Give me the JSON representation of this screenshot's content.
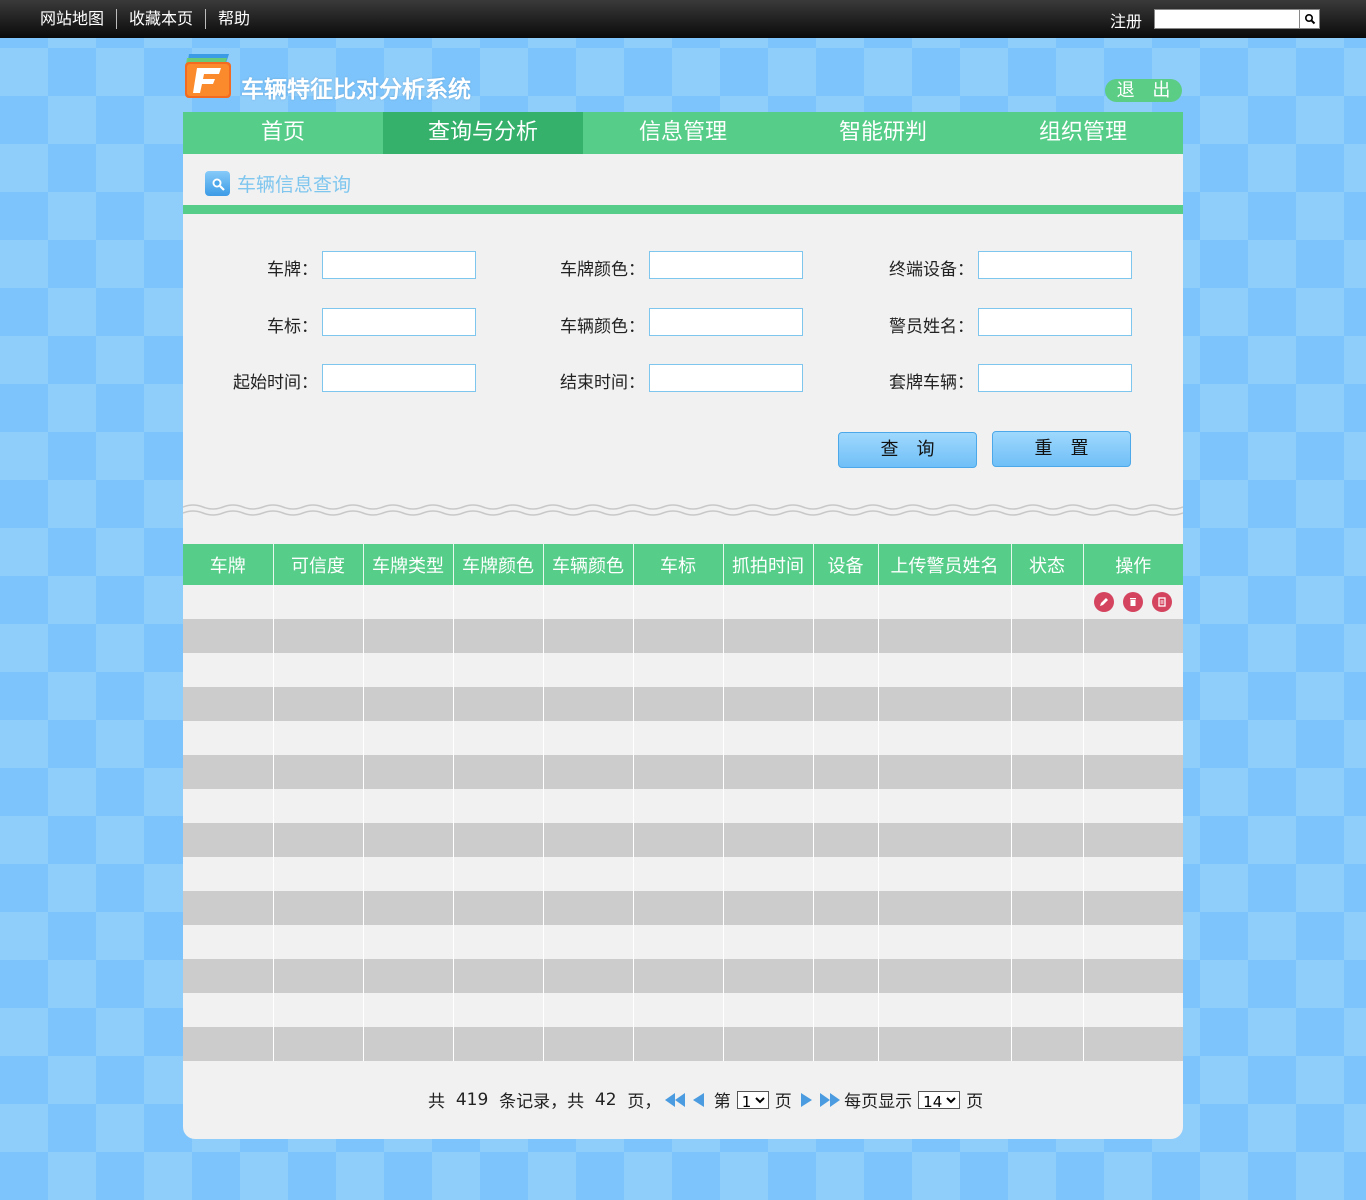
{
  "topbar": {
    "links": [
      "网站地图",
      "收藏本页",
      "帮助"
    ],
    "register": "注册",
    "search_value": ""
  },
  "header": {
    "title": "车辆特征比对分析系统",
    "logout": "退 出"
  },
  "nav": {
    "items": [
      "首页",
      "查询与分析",
      "信息管理",
      "智能研判",
      "组织管理"
    ],
    "active_index": 1
  },
  "section": {
    "title": "车辆信息查询"
  },
  "form": {
    "plate": "车牌：",
    "plate_color": "车牌颜色：",
    "terminal": "终端设备：",
    "logo": "车标：",
    "vehicle_color": "车辆颜色：",
    "officer": "警员姓名：",
    "start_time": "起始时间：",
    "end_time": "结束时间：",
    "cloned": "套牌车辆："
  },
  "buttons": {
    "query": "查询",
    "reset": "重置"
  },
  "table": {
    "headers": [
      "车牌",
      "可信度",
      "车牌类型",
      "车牌颜色",
      "车辆颜色",
      "车标",
      "抓拍时间",
      "设备",
      "上传警员姓名",
      "状态",
      "操作"
    ],
    "row_count": 14
  },
  "pager": {
    "total_prefix": "共",
    "total_records": "419",
    "records_mid": "条记录，共",
    "total_pages": "42",
    "pages_suffix": "页，",
    "page_prefix": "第",
    "current_page": "1",
    "page_suffix": "页",
    "per_page_prefix": "每页显示",
    "per_page": "14",
    "per_page_suffix": "页"
  },
  "colors": {
    "nav_green": "#56cd89",
    "nav_active": "#35b16c",
    "accent_blue": "#7fc6ef",
    "icon_red": "#d5445f"
  }
}
